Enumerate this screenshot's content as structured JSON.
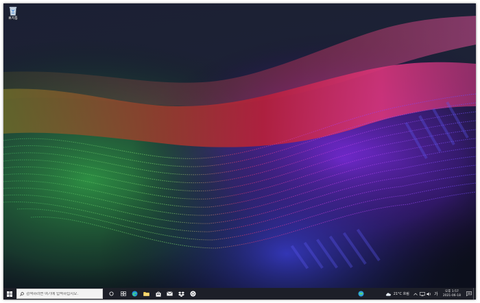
{
  "desktop": {
    "icons": [
      {
        "label": "휴지통",
        "icon": "recycle-bin-icon"
      }
    ],
    "wallpaper_colors": {
      "top": "#1b2033",
      "ribbon_olive": "#6b6a2a",
      "ribbon_red": "#b3203c",
      "ribbon_pink": "#d8357a",
      "green": "#2f9b45",
      "violet": "#7b2be0",
      "blue": "#3a3fd6"
    }
  },
  "taskbar": {
    "start_icon": "windows-logo-icon",
    "search": {
      "placeholder": "검색하려면 여기에 입력하십시오.",
      "icon": "search-icon"
    },
    "apps": [
      {
        "name": "cortana",
        "icon": "cortana-circle-icon"
      },
      {
        "name": "task-view",
        "icon": "task-view-icon"
      },
      {
        "name": "edge",
        "icon": "edge-icon"
      },
      {
        "name": "file-explorer",
        "icon": "folder-icon"
      },
      {
        "name": "store",
        "icon": "store-bag-icon"
      },
      {
        "name": "mail",
        "icon": "mail-icon"
      },
      {
        "name": "dropbox",
        "icon": "dropbox-icon"
      },
      {
        "name": "chrome",
        "icon": "chrome-icon"
      }
    ],
    "tray": {
      "pinned_app_icon": "browser-globe-icon",
      "weather": {
        "text": "21°C 흐림",
        "icon": "cloud-icon"
      },
      "icons": [
        "chevron-up-icon",
        "network-icon",
        "speaker-icon"
      ],
      "language": "가",
      "time": "오후 1:57",
      "date": "2021-06-18",
      "notification_icon": "notification-icon"
    },
    "colors": {
      "background": "#1d1f28",
      "search_bg": "#f3f3f3",
      "text": "#e8e8e8"
    }
  }
}
